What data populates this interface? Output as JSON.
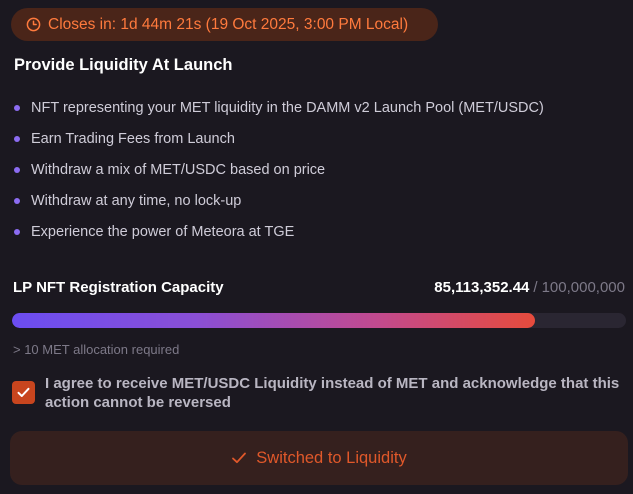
{
  "countdown": {
    "icon": "clock-icon",
    "text": "Closes in: 1d 44m 21s (19 Oct 2025, 3:00 PM Local)",
    "color": "#ff7a3d"
  },
  "section": {
    "title": "Provide Liquidity At Launch",
    "benefits": [
      "NFT representing your MET liquidity in the DAMM v2 Launch Pool (MET/USDC)",
      "Earn Trading Fees from Launch",
      "Withdraw a mix of MET/USDC based on price",
      "Withdraw at any time, no lock-up",
      "Experience the power of Meteora at TGE"
    ],
    "bullet_color": "#8c6cf2"
  },
  "capacity": {
    "label": "LP NFT Registration Capacity",
    "current": "85,113,352.44",
    "separator": "/",
    "total": "100,000,000",
    "progress_fraction": 0.851
  },
  "allocation_note": "> 10 MET allocation required",
  "agreement": {
    "checked": true,
    "text": "I agree to receive MET/USDC Liquidity instead of MET and acknowledge that this action cannot be reversed"
  },
  "action_button": {
    "icon": "check-icon",
    "label": "Switched to Liquidity",
    "color": "#e0582a"
  }
}
